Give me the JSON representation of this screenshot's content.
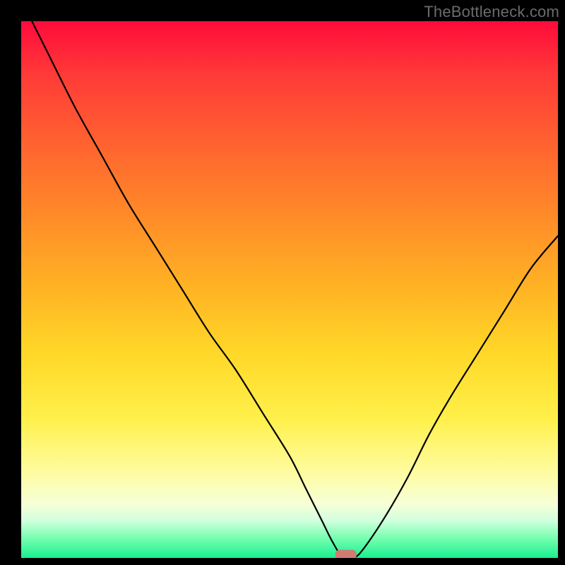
{
  "watermark": "TheBottleneck.com",
  "chart_data": {
    "type": "line",
    "title": "",
    "xlabel": "",
    "ylabel": "",
    "xlim": [
      0,
      100
    ],
    "ylim": [
      0,
      100
    ],
    "grid": false,
    "series": [
      {
        "name": "bottleneck-curve",
        "x": [
          2,
          5,
          10,
          15,
          20,
          25,
          30,
          35,
          40,
          45,
          50,
          53,
          56,
          58,
          60,
          62,
          64,
          68,
          72,
          76,
          80,
          85,
          90,
          95,
          100
        ],
        "y": [
          100,
          94,
          84,
          75,
          66,
          58,
          50,
          42,
          35,
          27,
          19,
          13,
          7,
          3,
          0,
          0,
          2,
          8,
          15,
          23,
          30,
          38,
          46,
          54,
          60
        ]
      }
    ],
    "annotations": [
      {
        "name": "minimum-marker",
        "x": 60.5,
        "y": 0.6,
        "color": "#d37a72",
        "shape": "rounded-bar"
      }
    ],
    "background_gradient": {
      "type": "vertical",
      "stops": [
        {
          "pos": 0.0,
          "color": "#ff0b3a"
        },
        {
          "pos": 0.5,
          "color": "#ffb424"
        },
        {
          "pos": 0.84,
          "color": "#fffca0"
        },
        {
          "pos": 0.96,
          "color": "#7fffb4"
        },
        {
          "pos": 1.0,
          "color": "#18f08f"
        }
      ]
    }
  }
}
